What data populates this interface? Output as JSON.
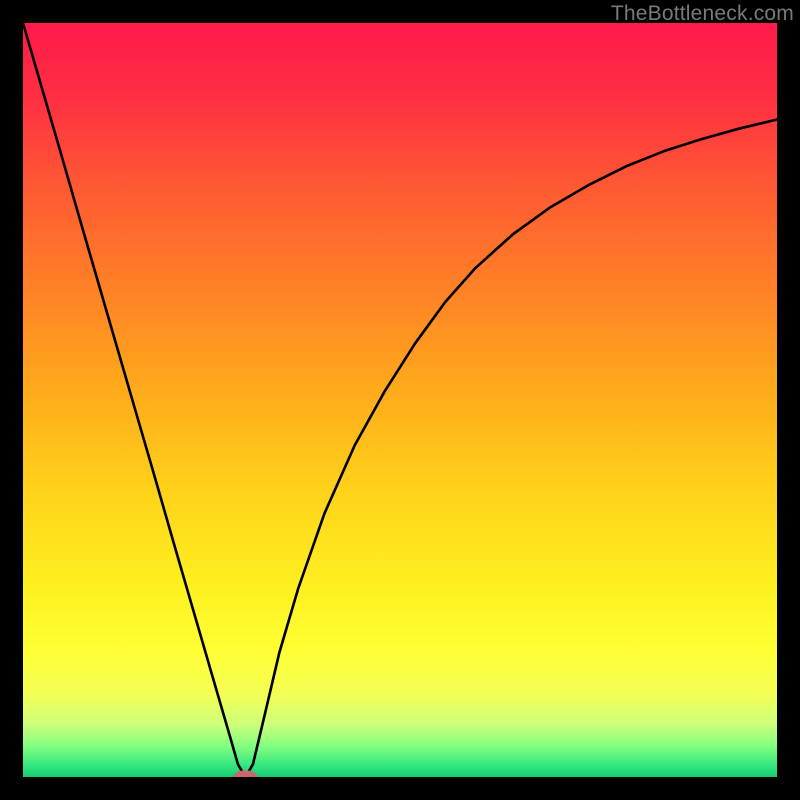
{
  "watermark": "TheBottleneck.com",
  "chart_data": {
    "type": "line",
    "title": "",
    "xlabel": "",
    "ylabel": "",
    "xlim": [
      0,
      100
    ],
    "ylim": [
      0,
      100
    ],
    "background_gradient": {
      "stops": [
        {
          "offset": 0.0,
          "color": "#ff1a4b"
        },
        {
          "offset": 0.1,
          "color": "#ff2f42"
        },
        {
          "offset": 0.22,
          "color": "#ff5a33"
        },
        {
          "offset": 0.35,
          "color": "#ff8026"
        },
        {
          "offset": 0.5,
          "color": "#ffae1a"
        },
        {
          "offset": 0.62,
          "color": "#ffd21a"
        },
        {
          "offset": 0.75,
          "color": "#fff01f"
        },
        {
          "offset": 0.83,
          "color": "#ffff33"
        },
        {
          "offset": 0.89,
          "color": "#f4ff55"
        },
        {
          "offset": 0.93,
          "color": "#ccff7a"
        },
        {
          "offset": 0.96,
          "color": "#80ff80"
        },
        {
          "offset": 0.985,
          "color": "#33e680"
        },
        {
          "offset": 1.0,
          "color": "#14cc6e"
        }
      ]
    },
    "series": [
      {
        "name": "curve",
        "x": [
          0.0,
          2.5,
          5.0,
          7.5,
          10.0,
          12.5,
          15.0,
          17.5,
          20.0,
          22.5,
          25.0,
          27.5,
          28.5,
          29.5,
          30.5,
          32.0,
          34.0,
          36.5,
          40.0,
          44.0,
          48.0,
          52.0,
          56.0,
          60.0,
          65.0,
          70.0,
          75.0,
          80.0,
          85.0,
          90.0,
          95.0,
          100.0
        ],
        "y": [
          100.0,
          91.4,
          82.8,
          74.1,
          65.5,
          56.9,
          48.3,
          39.7,
          31.0,
          22.4,
          13.8,
          5.2,
          1.7,
          0.0,
          1.7,
          8.0,
          16.5,
          25.0,
          35.0,
          44.0,
          51.2,
          57.5,
          63.0,
          67.5,
          72.0,
          75.6,
          78.5,
          81.0,
          83.0,
          84.6,
          86.0,
          87.2
        ]
      }
    ],
    "marker": {
      "x": 29.5,
      "y": 0.0,
      "rx": 1.6,
      "ry": 0.9,
      "color": "#c46a6a"
    }
  }
}
